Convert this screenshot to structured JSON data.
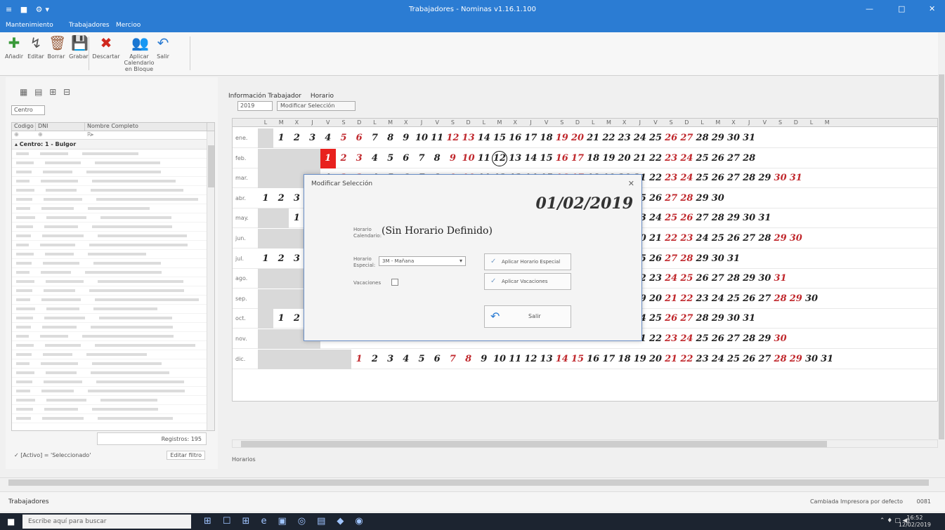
{
  "window": {
    "title": "Trabajadores - Nominas v1.16.1.100",
    "quick_access": "≡ ■ ⚙▾",
    "controls": [
      "—",
      "□",
      "✕"
    ]
  },
  "menu": [
    "Mantenimiento",
    "Trabajadores",
    "Mercioo"
  ],
  "ribbon": {
    "buttons": [
      {
        "label": "Añadir",
        "icon": "add-icon",
        "glyph": "✚",
        "color": "#3a9a3a"
      },
      {
        "label": "Editar",
        "icon": "edit-icon",
        "glyph": "↯",
        "color": "#555555"
      },
      {
        "label": "Borrar",
        "icon": "delete-icon",
        "glyph": "🗑",
        "color": "#9a6040"
      },
      {
        "label": "Grabar",
        "icon": "save-icon",
        "glyph": "💾",
        "color": "#2b7cd3"
      },
      {
        "label": "Descartar",
        "icon": "discard-icon",
        "glyph": "✖",
        "color": "#d0281e"
      },
      {
        "label": "Aplicar Calendario en Bloque",
        "icon": "users-calendar-icon",
        "glyph": "👥",
        "color": "#3a7ab0"
      },
      {
        "label": "Salir",
        "icon": "exit-icon",
        "glyph": "↶",
        "color": "#2b7cd3"
      }
    ]
  },
  "left_panel": {
    "icons": "▦ ▤ ⊞ ⊟",
    "group_combo": "Centro",
    "columns": [
      "Codigo",
      "DNI",
      "Nombre Completo"
    ],
    "filter_glyphs": [
      "⊕",
      "⊕",
      "R▸"
    ],
    "group_row": "▴ Centro: 1 - Bulgor",
    "count_label": "Registros: 195",
    "filter_bar": "✓ [Activo] = 'Seleccionado'",
    "edit_filter": "Editar filtro"
  },
  "tabs": [
    "Información Trabajador",
    "Horario"
  ],
  "toolbar": {
    "year": "2019",
    "modify_button": "Modificar Selección"
  },
  "calendar": {
    "header": [
      "L",
      "M",
      "X",
      "J",
      "V",
      "S",
      "D",
      "L",
      "M",
      "X",
      "J",
      "V",
      "S",
      "D",
      "L",
      "M",
      "X",
      "J",
      "V",
      "S",
      "D",
      "L",
      "M",
      "X",
      "J",
      "V",
      "S",
      "D",
      "L",
      "M",
      "X",
      "J",
      "V",
      "S",
      "D",
      "L",
      "M"
    ],
    "months": [
      {
        "label": "ene.",
        "start": 1,
        "days": 31
      },
      {
        "label": "feb.",
        "start": 4,
        "days": 28
      },
      {
        "label": "mar.",
        "start": 4,
        "days": 31
      },
      {
        "label": "abr.",
        "start": 0,
        "days": 30
      },
      {
        "label": "may.",
        "start": 2,
        "days": 31
      },
      {
        "label": "jun.",
        "start": 5,
        "days": 30
      },
      {
        "label": "jul.",
        "start": 0,
        "days": 31
      },
      {
        "label": "ago.",
        "start": 3,
        "days": 31
      },
      {
        "label": "sep.",
        "start": 6,
        "days": 30
      },
      {
        "label": "oct.",
        "start": 1,
        "days": 31
      },
      {
        "label": "nov.",
        "start": 4,
        "days": 30
      },
      {
        "label": "dic.",
        "start": 6,
        "days": 31
      }
    ],
    "selected": {
      "month": 1,
      "day": 1
    },
    "circled": {
      "month": 1,
      "day": 12
    },
    "footer": "Horarios"
  },
  "modal": {
    "title": "Modificar Selección",
    "close": "✕",
    "date": "01/02/2019",
    "horario_label": "Horario Calendario:",
    "horario_value": "(Sin Horario Definido)",
    "especial_label": "Horario Especial:",
    "especial_value": "3M - Mañana",
    "vacaciones_label": "Vacaciones",
    "btn_especial": "Aplicar Horario Especial",
    "btn_vacaciones": "Aplicar Vacaciones",
    "btn_exit": "Salir"
  },
  "status": {
    "tab": "Trabajadores",
    "printer": "Cambiada Impresora por defecto",
    "version": "0081"
  },
  "taskbar": {
    "search": "Escribe aquí para buscar",
    "clock_time": "16:52",
    "clock_date": "12/02/2019"
  }
}
